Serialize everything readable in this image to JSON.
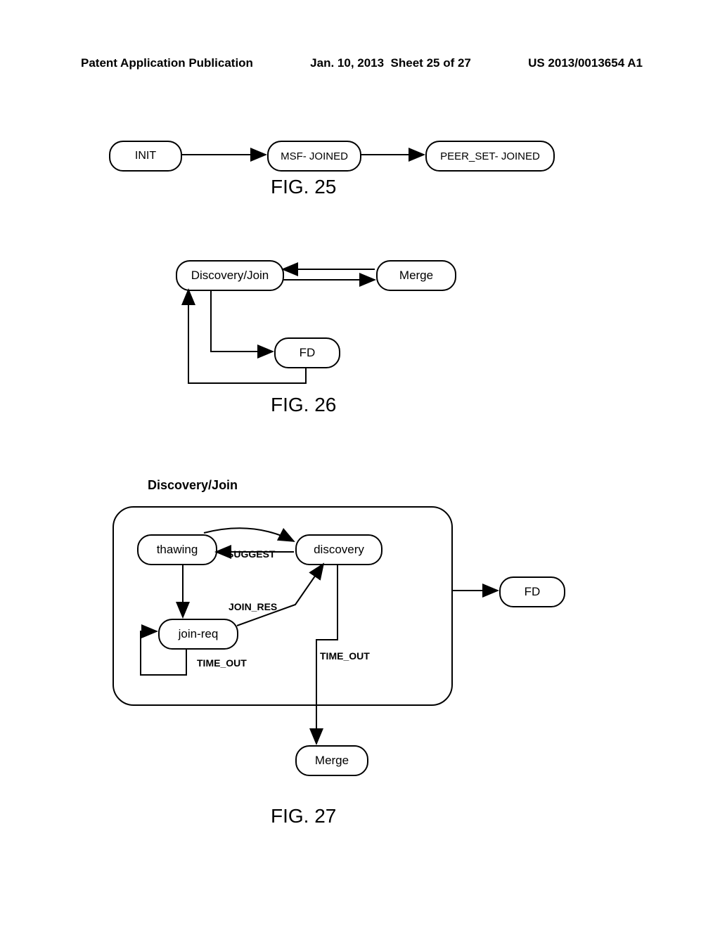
{
  "header": {
    "left": "Patent Application Publication",
    "date": "Jan. 10, 2013",
    "sheet": "Sheet 25 of 27",
    "pubno": "US 2013/0013654 A1"
  },
  "fig25": {
    "init": "INIT",
    "msf": "MSF- JOINED",
    "peer": "PEER_SET- JOINED",
    "caption": "FIG. 25"
  },
  "fig26": {
    "discovery": "Discovery/Join",
    "merge": "Merge",
    "fd": "FD",
    "caption": "FIG. 26"
  },
  "fig27": {
    "title": "Discovery/Join",
    "thawing": "thawing",
    "discovery": "discovery",
    "joinreq": "join-req",
    "fd": "FD",
    "merge": "Merge",
    "suggest": "SUGGEST",
    "joinres": "JOIN_RES",
    "timeout1": "TIME_OUT",
    "timeout2": "TIME_OUT",
    "caption": "FIG. 27"
  }
}
